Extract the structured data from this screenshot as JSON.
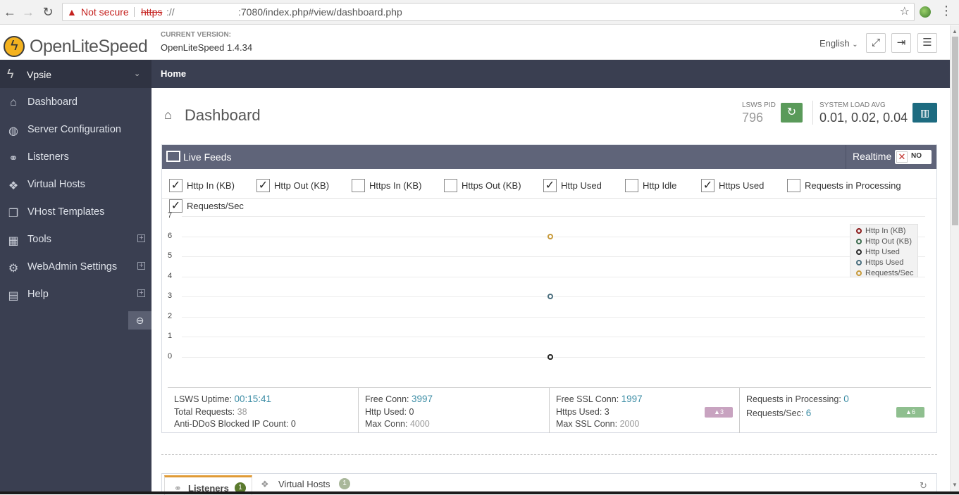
{
  "browser": {
    "security_label": "Not secure",
    "url_scheme": "https",
    "url_scheme_sep": "://",
    "url_path": ":7080/index.php#view/dashboard.php"
  },
  "header": {
    "logo_text": "OpenLiteSpeed",
    "current_version_label": "CURRENT VERSION:",
    "current_version_value": "OpenLiteSpeed 1.4.34",
    "language": "English"
  },
  "sidebar": {
    "server_name": "Vpsie",
    "items": [
      {
        "label": "Dashboard",
        "icon": "home-icon"
      },
      {
        "label": "Server Configuration",
        "icon": "globe-icon"
      },
      {
        "label": "Listeners",
        "icon": "link-icon"
      },
      {
        "label": "Virtual Hosts",
        "icon": "cubes-icon"
      },
      {
        "label": "VHost Templates",
        "icon": "templates-icon"
      },
      {
        "label": "Tools",
        "icon": "grid-icon"
      },
      {
        "label": "WebAdmin Settings",
        "icon": "gear-icon"
      },
      {
        "label": "Help",
        "icon": "book-icon"
      }
    ]
  },
  "breadcrumb": {
    "home": "Home"
  },
  "page": {
    "title": "Dashboard",
    "pid_label": "LSWS PID",
    "pid_value": "796",
    "load_label": "SYSTEM LOAD AVG",
    "load_value": "0.01, 0.02, 0.04"
  },
  "live_feeds": {
    "title": "Live Feeds",
    "realtime_label": "Realtime",
    "realtime_state": "NO",
    "checkboxes": [
      {
        "label": "Http In (KB)",
        "checked": true
      },
      {
        "label": "Http Out (KB)",
        "checked": true
      },
      {
        "label": "Https In (KB)",
        "checked": false
      },
      {
        "label": "Https Out (KB)",
        "checked": false
      },
      {
        "label": "Http Used",
        "checked": true
      },
      {
        "label": "Http Idle",
        "checked": false
      },
      {
        "label": "Https Used",
        "checked": true
      },
      {
        "label": "Requests in Processing",
        "checked": false
      },
      {
        "label": "Requests/Sec",
        "checked": true
      }
    ]
  },
  "chart_data": {
    "type": "scatter",
    "ylim": [
      0,
      7
    ],
    "yticks": [
      "0",
      "1",
      "2",
      "3",
      "4",
      "5",
      "6",
      "7"
    ],
    "grid": true,
    "legend_position": "top-right",
    "series": [
      {
        "name": "Http In (KB)",
        "color": "#8b1a1a",
        "values": [
          0
        ]
      },
      {
        "name": "Http Out (KB)",
        "color": "#3d6b4e",
        "values": [
          0
        ]
      },
      {
        "name": "Http Used",
        "color": "#2b2b2b",
        "values": [
          0
        ]
      },
      {
        "name": "Https Used",
        "color": "#4a6e7e",
        "values": [
          3
        ]
      },
      {
        "name": "Requests/Sec",
        "color": "#c79a3a",
        "values": [
          6
        ]
      }
    ]
  },
  "stats": {
    "uptime_label": "LSWS Uptime:",
    "uptime_value": "00:15:41",
    "total_req_label": "Total Requests:",
    "total_req_value": "38",
    "ddos_label": "Anti-DDoS Blocked IP Count:",
    "ddos_value": "0",
    "free_conn_label": "Free Conn:",
    "free_conn_value": "3997",
    "http_used_label": "Http Used:",
    "http_used_value": "0",
    "max_conn_label": "Max Conn:",
    "max_conn_value": "4000",
    "free_ssl_label": "Free SSL Conn:",
    "free_ssl_value": "1997",
    "https_used_label": "Https Used:",
    "https_used_value": "3",
    "max_ssl_label": "Max SSL Conn:",
    "max_ssl_value": "2000",
    "ssl_badge": "▲3",
    "req_proc_label": "Requests in Processing:",
    "req_proc_value": "0",
    "req_sec_label": "Requests/Sec:",
    "req_sec_value": "6",
    "req_badge": "▲6"
  },
  "tabs": [
    {
      "label": "Listeners",
      "count": "1"
    },
    {
      "label": "Virtual Hosts",
      "count": "1"
    }
  ]
}
